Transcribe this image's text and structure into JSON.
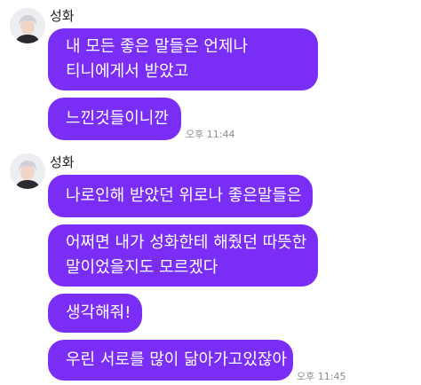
{
  "conversation": {
    "groups": [
      {
        "sender": "성화",
        "messages": [
          {
            "lines": [
              "내 모든 좋은 말들은 언제나",
              "티니에게서 받았고"
            ]
          },
          {
            "lines": [
              "느낀것들이니깐"
            ]
          }
        ],
        "timestamp": "오후 11:44"
      },
      {
        "sender": "성화",
        "messages": [
          {
            "lines": [
              "나로인해 받았던 위로나 좋은말들은"
            ]
          },
          {
            "lines": [
              "어쩌면 내가 성화한테 해줬던 따뜻한",
              "말이었을지도 모르겠다"
            ]
          },
          {
            "lines": [
              "생각해줘!"
            ]
          },
          {
            "lines": [
              "우린 서로를 많이 닮아가고있잖아"
            ]
          }
        ],
        "timestamp": "오후 11:45"
      }
    ]
  },
  "colors": {
    "bubble": "#7a2ef5",
    "bubble_text": "#ffffff",
    "timestamp": "#8c8c8c",
    "sender": "#222222"
  },
  "icons": {
    "avatar": "profile-photo"
  }
}
